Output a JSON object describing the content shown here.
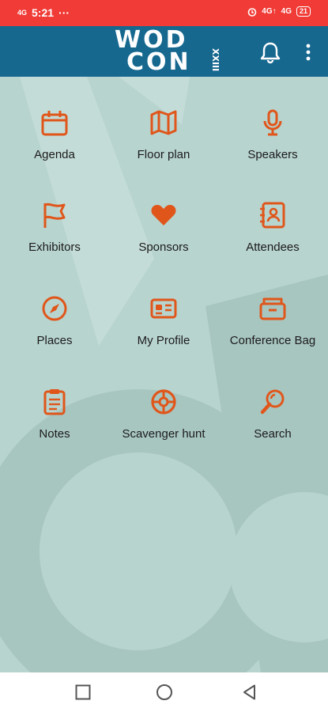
{
  "status_bar": {
    "time": "5:21",
    "dots": "···",
    "network_left": "4G",
    "network_right": "4G",
    "volte": "4G↑",
    "battery": "21"
  },
  "app_bar": {
    "logo_line1": "WOD",
    "logo_line2": "CON",
    "logo_roman": "XXIII"
  },
  "menu": [
    {
      "label": "Agenda",
      "icon": "calendar-icon"
    },
    {
      "label": "Floor plan",
      "icon": "map-icon"
    },
    {
      "label": "Speakers",
      "icon": "microphone-icon"
    },
    {
      "label": "Exhibitors",
      "icon": "flag-icon"
    },
    {
      "label": "Sponsors",
      "icon": "heart-icon"
    },
    {
      "label": "Attendees",
      "icon": "contacts-icon"
    },
    {
      "label": "Places",
      "icon": "compass-icon"
    },
    {
      "label": "My Profile",
      "icon": "id-card-icon"
    },
    {
      "label": "Conference Bag",
      "icon": "bag-icon"
    },
    {
      "label": "Notes",
      "icon": "notes-icon"
    },
    {
      "label": "Scavenger hunt",
      "icon": "crosshair-icon"
    },
    {
      "label": "Search",
      "icon": "search-icon"
    }
  ],
  "colors": {
    "status_bar": "#f03b36",
    "app_bar": "#16688f",
    "background": "#b8d4cf",
    "accent": "#e0561a"
  }
}
